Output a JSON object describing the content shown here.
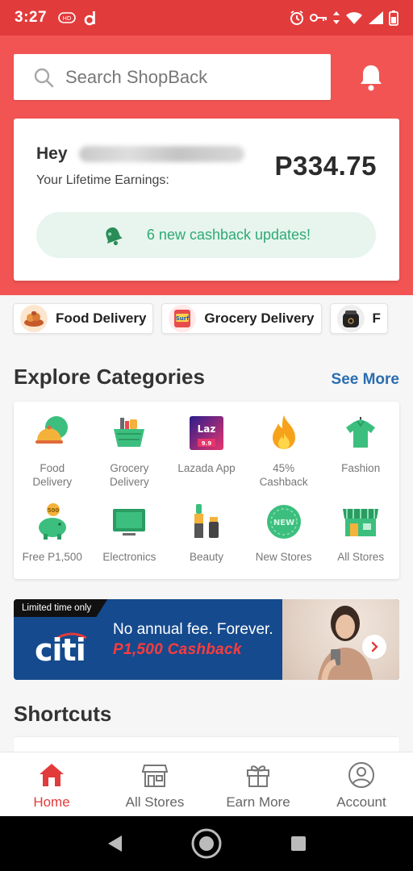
{
  "status_bar": {
    "time": "3:27",
    "battery_icon": "battery-icon",
    "signal_icon": "signal-icon"
  },
  "header": {
    "search_placeholder": "Search ShopBack",
    "bell_icon": "bell-icon",
    "greeting": "Hey",
    "lifetime_label": "Your Lifetime Earnings:",
    "amount": "P334.75",
    "updates": "6 new cashback updates!"
  },
  "chips": [
    {
      "label": "Food Delivery"
    },
    {
      "label": "Grocery Delivery"
    },
    {
      "label": "F"
    }
  ],
  "explore": {
    "title": "Explore Categories",
    "see_more": "See More",
    "items": [
      {
        "label": "Food\nDelivery",
        "icon": "food-delivery-icon"
      },
      {
        "label": "Grocery\nDelivery",
        "icon": "grocery-basket-icon"
      },
      {
        "label": "Lazada App",
        "icon": "lazada-icon"
      },
      {
        "label": "45%\nCashback",
        "icon": "flame-icon"
      },
      {
        "label": "Fashion",
        "icon": "shirt-icon"
      },
      {
        "label": "Free P1,500",
        "icon": "piggy-bank-icon"
      },
      {
        "label": "Electronics",
        "icon": "monitor-icon"
      },
      {
        "label": "Beauty",
        "icon": "lipstick-icon"
      },
      {
        "label": "New Stores",
        "icon": "new-badge-icon"
      },
      {
        "label": "All Stores",
        "icon": "storefront-icon"
      }
    ],
    "lazada_logo_text": "Laz",
    "new_badge_text": "NEW",
    "piggy_coin_text": "500"
  },
  "banner": {
    "tag": "Limited time only",
    "brand": "citi",
    "line1": "No annual fee. Forever.",
    "line2": "P1,500 Cashback"
  },
  "shortcuts": {
    "title": "Shortcuts"
  },
  "tabbar": {
    "items": [
      {
        "label": "Home",
        "active": true
      },
      {
        "label": "All Stores",
        "active": false
      },
      {
        "label": "Earn More",
        "active": false
      },
      {
        "label": "Account",
        "active": false
      }
    ]
  },
  "colors": {
    "brand_red": "#f25454",
    "status_red": "#e23b3b",
    "cashback_green": "#2faa72",
    "link_blue": "#2a6db0",
    "citi_blue": "#154a8e"
  }
}
